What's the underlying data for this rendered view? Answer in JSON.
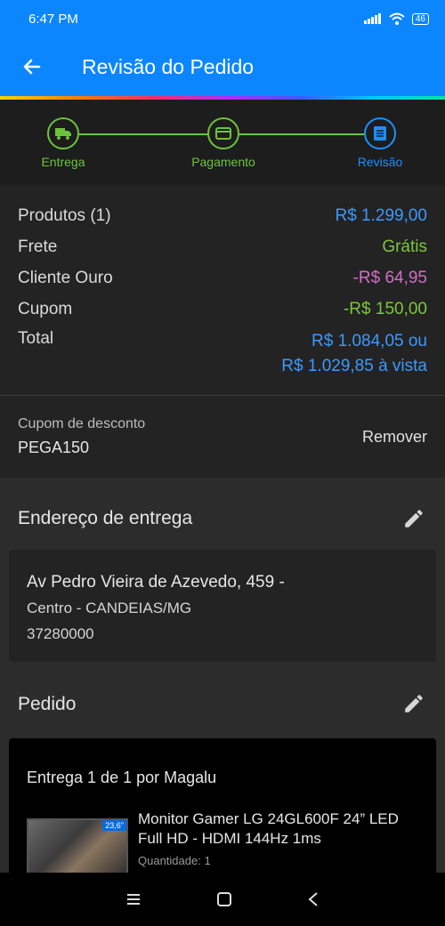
{
  "status_bar": {
    "time": "6:47 PM",
    "battery": "46",
    "icons": [
      "signal-icon",
      "wifi-icon",
      "battery-icon"
    ]
  },
  "app_bar": {
    "title": "Revisão do Pedido",
    "back_icon": "back-arrow-icon"
  },
  "stepper": {
    "steps": [
      {
        "label": "Entrega",
        "icon": "truck-icon",
        "state": "done"
      },
      {
        "label": "Pagamento",
        "icon": "card-icon",
        "state": "done"
      },
      {
        "label": "Revisão",
        "icon": "document-icon",
        "state": "active"
      }
    ]
  },
  "summary": {
    "products_label": "Produtos (1)",
    "products_value": "R$ 1.299,00",
    "shipping_label": "Frete",
    "shipping_value": "Grátis",
    "gold_label": "Cliente Ouro",
    "gold_value": "-R$ 64,95",
    "coupon_label": "Cupom",
    "coupon_value": "-R$ 150,00",
    "total_label": "Total",
    "total_value_line1": "R$ 1.084,05 ou",
    "total_value_line2": "R$ 1.029,85 à vista"
  },
  "coupon": {
    "label": "Cupom de desconto",
    "code": "PEGA150",
    "remove_label": "Remover"
  },
  "address": {
    "title": "Endereço de entrega",
    "line1": "Av Pedro Vieira de Azevedo, 459 -",
    "line2": "Centro - CANDEIAS/MG",
    "line3": "37280000"
  },
  "order": {
    "title": "Pedido",
    "delivery_title": "Entrega 1 de 1 por Magalu",
    "product_name": "Monitor Gamer LG 24GL600F 24” LED Full HD - HDMI 144Hz 1ms",
    "product_qty": "Quantidade:  1",
    "thumb_badge": "23,6\""
  },
  "colors": {
    "primary": "#0b86ff",
    "step_done": "#6cc33b",
    "step_active": "#1a90ff",
    "price_blue": "#3b99ff",
    "free_green": "#7cc63f",
    "discount_pink": "#d06ec6"
  }
}
